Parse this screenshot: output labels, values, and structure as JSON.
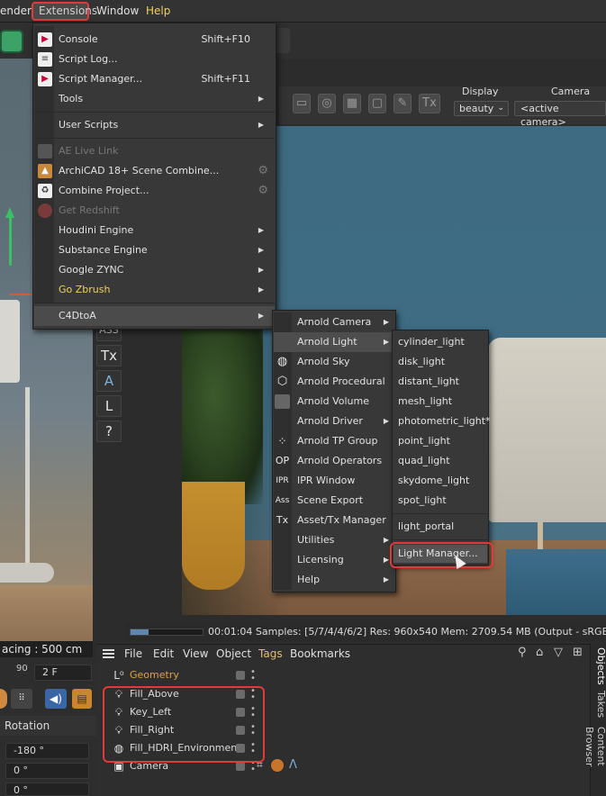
{
  "menubar": {
    "render": "ender",
    "extensions": "Extensions",
    "window": "Window",
    "help": "Help"
  },
  "render_view": {
    "display_label": "Display",
    "camera_label": "Camera",
    "display_value": "beauty",
    "camera_value": "<active camera>",
    "tx_button": "Tx",
    "status": "00:01:04  Samples: [5/7/4/4/6/2]  Res: 960x540  Mem: 2709.54 MB  (Output - sRGB)",
    "progress": 0.25
  },
  "viewport": {
    "spacing": "acing : 500 cm"
  },
  "side_strip": [
    "ASS",
    "Tx",
    "A",
    "L",
    "?"
  ],
  "extensions_menu": {
    "items": [
      {
        "label": "Console",
        "shortcut": "Shift+F10"
      },
      {
        "label": "Script Log..."
      },
      {
        "label": "Script Manager...",
        "shortcut": "Shift+F11"
      },
      {
        "label": "Tools"
      },
      {
        "label": "User Scripts"
      },
      {
        "label": "AE Live Link"
      },
      {
        "label": "ArchiCAD 18+ Scene Combine..."
      },
      {
        "label": "Combine Project..."
      },
      {
        "label": "Get Redshift"
      },
      {
        "label": "Houdini Engine"
      },
      {
        "label": "Substance Engine"
      },
      {
        "label": "Google ZYNC"
      },
      {
        "label": "Go Zbrush"
      },
      {
        "label": "C4DtoA"
      }
    ]
  },
  "c4dtoa_menu": {
    "items": [
      {
        "label": "Arnold Camera",
        "icon": ""
      },
      {
        "label": "Arnold Light",
        "icon": ""
      },
      {
        "label": "Arnold Sky",
        "icon": "globe-icon"
      },
      {
        "label": "Arnold Procedural",
        "icon": "cube-icon"
      },
      {
        "label": "Arnold Volume",
        "icon": "volume-icon"
      },
      {
        "label": "Arnold Driver",
        "icon": ""
      },
      {
        "label": "Arnold TP Group",
        "icon": "particles-icon"
      },
      {
        "label": "Arnold Operators",
        "icon": "OP"
      },
      {
        "label": "IPR Window",
        "icon": "IPR"
      },
      {
        "label": "Scene Export",
        "icon": "Ass"
      },
      {
        "label": "Asset/Tx Manager",
        "icon": "Tx"
      },
      {
        "label": "Utilities",
        "icon": ""
      },
      {
        "label": "Licensing",
        "icon": ""
      },
      {
        "label": "Help",
        "icon": ""
      }
    ]
  },
  "light_menu": {
    "items": [
      "cylinder_light",
      "disk_light",
      "distant_light",
      "mesh_light",
      "photometric_light*",
      "point_light",
      "quad_light",
      "skydome_light",
      "spot_light"
    ],
    "portal": "light_portal",
    "manager": "Light Manager..."
  },
  "object_manager": {
    "menu": [
      "File",
      "Edit",
      "View",
      "Object",
      "Tags",
      "Bookmarks"
    ],
    "rows": [
      {
        "name": "Geometry"
      },
      {
        "name": "Fill_Above"
      },
      {
        "name": "Key_Left"
      },
      {
        "name": "Fill_Right"
      },
      {
        "name": "Fill_HDRI_Environment"
      },
      {
        "name": "Camera"
      }
    ],
    "tabs": [
      "Objects",
      "Takes",
      "Content Browser"
    ]
  },
  "attributes": {
    "field_top_left": "90",
    "frame_field": "2 F",
    "rotation_label": "Rotation",
    "rot_values": [
      "-180 °",
      "0 °",
      "0 °"
    ]
  },
  "colors": {
    "accent_red": "#e03a3a",
    "help_yellow": "#f2d15c",
    "geometry_orange": "#e0a23a"
  }
}
